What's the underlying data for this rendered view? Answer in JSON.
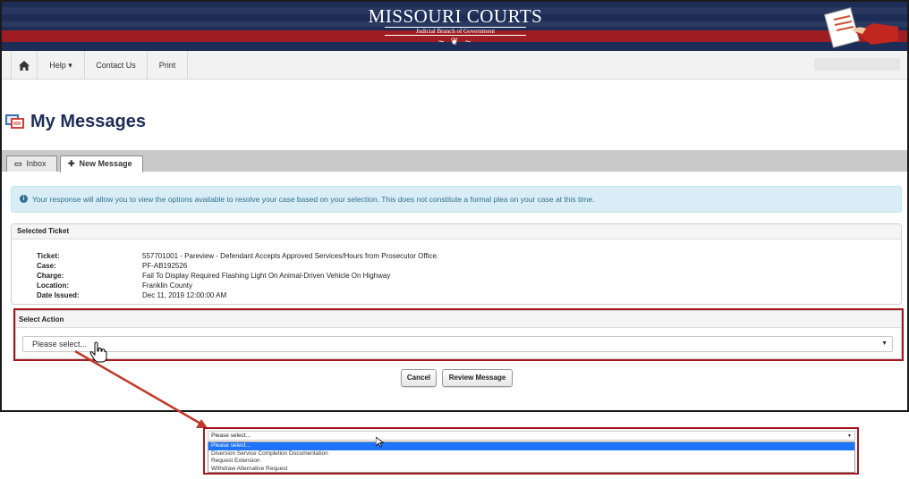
{
  "banner": {
    "logo_main": "MISSOURI COURTS",
    "logo_sub": "Judicial Branch of Government"
  },
  "nav": {
    "help": "Help ▾",
    "contact": "Contact Us",
    "print": "Print"
  },
  "page": {
    "title": "My Messages"
  },
  "tabs": [
    {
      "label": "Inbox"
    },
    {
      "label": "New Message"
    }
  ],
  "alert": {
    "text": "Your response will allow you to view the options available to resolve your case based on your selection. This does not constitute a formal plea on your case at this time."
  },
  "ticket_panel": {
    "heading": "Selected Ticket",
    "rows": [
      {
        "label": "Ticket:",
        "value": "557701001 - Pareview - Defendant Accepts Approved Services/Hours from Prosecutor Office."
      },
      {
        "label": "Case:",
        "value": "PF-AB192526"
      },
      {
        "label": "Charge:",
        "value": "Fail To Display Required Flashing Light On Animal-Driven Vehicle On Highway"
      },
      {
        "label": "Location:",
        "value": "Franklin County"
      },
      {
        "label": "Date Issued:",
        "value": "Dec 11, 2019 12:00:00 AM"
      }
    ]
  },
  "action_panel": {
    "heading": "Select Action",
    "selected": "Please select..."
  },
  "buttons": {
    "cancel": "Cancel",
    "review": "Review Message"
  },
  "dropdown_popup": {
    "selected": "Please select...",
    "options": [
      "Please select...",
      "Diversion Service Completion Documentation",
      "Request Extension",
      "Withdraw Alternative Request"
    ],
    "highlighted_index": 0
  },
  "colors": {
    "navy": "#1d2d57",
    "crimson": "#a5171c",
    "alert_bg": "#d9edf7",
    "highlight": "#1e73ff"
  },
  "icons": [
    "home-icon",
    "inbox-icon",
    "plus-icon",
    "info-icon",
    "messages-icon",
    "hand-cursor-icon",
    "pointer-cursor-icon",
    "document-hand-icon"
  ]
}
